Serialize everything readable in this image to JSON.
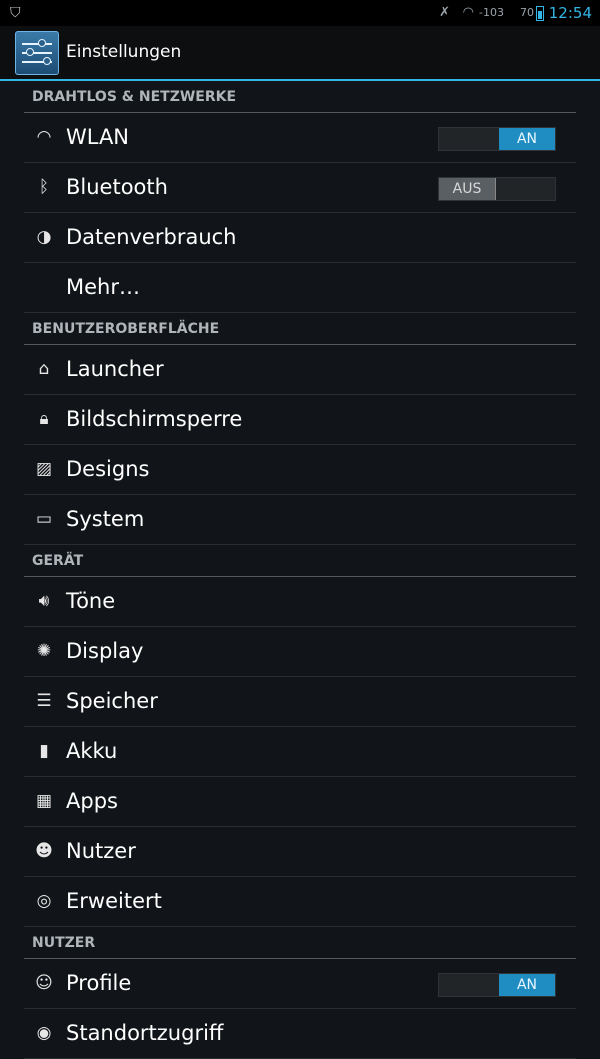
{
  "status_bar": {
    "notification_icon": "shield-icon",
    "signal_text": "-103",
    "battery_percent": "70",
    "time": "12:54"
  },
  "action_bar": {
    "app_icon": "settings-sliders-icon",
    "title": "Einstellungen"
  },
  "sections": [
    {
      "header": "DRAHTLOS & NETZWERKE",
      "items": [
        {
          "icon": "wifi-icon",
          "label": "WLAN",
          "toggle": "AN"
        },
        {
          "icon": "bluetooth-icon",
          "label": "Bluetooth",
          "toggle": "AUS"
        },
        {
          "icon": "data-usage-icon",
          "label": "Datenverbrauch"
        },
        {
          "icon": "",
          "label": "Mehr…"
        }
      ]
    },
    {
      "header": "BENUTZEROBERFLÄCHE",
      "items": [
        {
          "icon": "launcher-icon",
          "label": "Launcher"
        },
        {
          "icon": "lock-icon",
          "label": "Bildschirmsperre"
        },
        {
          "icon": "themes-icon",
          "label": "Designs"
        },
        {
          "icon": "system-icon",
          "label": "System"
        }
      ]
    },
    {
      "header": "GERÄT",
      "items": [
        {
          "icon": "sound-icon",
          "label": "Töne"
        },
        {
          "icon": "brightness-icon",
          "label": "Display"
        },
        {
          "icon": "storage-icon",
          "label": "Speicher"
        },
        {
          "icon": "battery-icon",
          "label": "Akku"
        },
        {
          "icon": "apps-icon",
          "label": "Apps"
        },
        {
          "icon": "user-icon",
          "label": "Nutzer"
        },
        {
          "icon": "advanced-icon",
          "label": "Erweitert"
        }
      ]
    },
    {
      "header": "NUTZER",
      "items": [
        {
          "icon": "profile-icon",
          "label": "Profile",
          "toggle": "AN"
        },
        {
          "icon": "location-icon",
          "label": "Standortzugriff"
        }
      ]
    }
  ]
}
